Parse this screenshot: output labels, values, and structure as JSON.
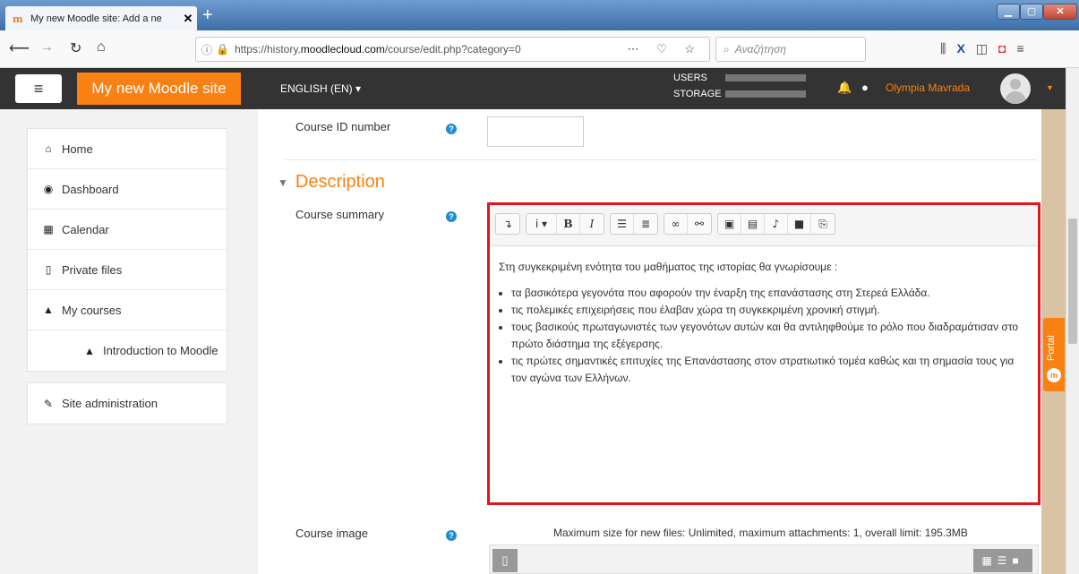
{
  "browser": {
    "tab_title": "My new Moodle site: Add a ne",
    "tab_favicon": "moodle-icon",
    "url_prefix": "https://history.",
    "url_domain": "moodlecloud.com",
    "url_path": "/course/edit.php?category=0",
    "search_placeholder": "Αναζήτηση"
  },
  "header": {
    "site_name": "My new Moodle site",
    "language": "ENGLISH (EN)",
    "quota_users_label": "USERS",
    "quota_storage_label": "STORAGE",
    "user_name": "Olympia Mavrada",
    "accent_color": "#f98012"
  },
  "sidebar": {
    "items": [
      {
        "icon": "home-icon",
        "glyph": "⌂",
        "label": "Home"
      },
      {
        "icon": "dashboard-icon",
        "glyph": "◉",
        "label": "Dashboard"
      },
      {
        "icon": "calendar-icon",
        "glyph": "▦",
        "label": "Calendar"
      },
      {
        "icon": "file-icon",
        "glyph": "▯",
        "label": "Private files"
      },
      {
        "icon": "mortarboard-icon",
        "glyph": "▲",
        "label": "My courses"
      },
      {
        "icon": "mortarboard-icon",
        "glyph": "▲",
        "label": "Introduction to Moodle"
      }
    ],
    "admin": {
      "icon": "wrench-icon",
      "glyph": "✎",
      "label": "Site administration"
    }
  },
  "form": {
    "course_id_label": "Course ID number",
    "course_id_value": "",
    "section_title": "Description",
    "summary_label": "Course summary",
    "summary_intro": "Στη συγκεκριμένη ενότητα του μαθήματος της ιστορίας θα γνωρίσουμε :",
    "summary_bullets": [
      "τα βασικότερα γεγονότα που αφορούν την έναρξη της επανάστασης στη Στερεά Ελλάδα.",
      "τις πολεμικές επιχειρήσεις που έλαβαν χώρα τη συγκεκριμένη χρονική στιγμή.",
      "τους βασικούς πρωταγωνιστές των γεγονότων αυτών και θα αντιληφθούμε το ρόλο που διαδραμάτισαν στο πρώτο διάστημα της εξέγερσης.",
      "τις πρώτες σημαντικές επιτυχίες της Επανάστασης στον στρατιωτικό τομέα καθώς και τη σημασία τους για τον αγώνα των Ελλήνων."
    ],
    "course_image_label": "Course image",
    "file_limits": "Maximum size for new files: Unlimited, maximum attachments: 1, overall limit: 195.3MB"
  },
  "portal": {
    "label": "Portal"
  }
}
